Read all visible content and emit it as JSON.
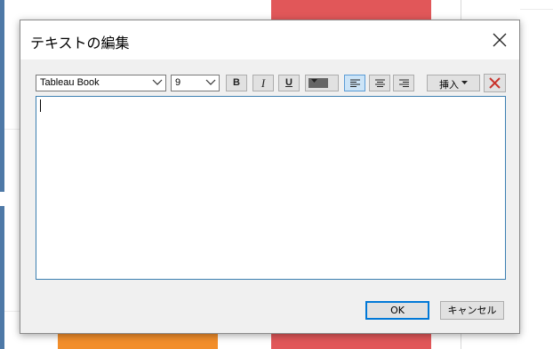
{
  "dialog": {
    "title": "テキストの編集",
    "close_icon": "close-icon"
  },
  "toolbar": {
    "font_family": "Tableau Book",
    "font_size": "9",
    "bold_label": "B",
    "italic_label": "I",
    "underline_label": "U",
    "text_color": "#666666",
    "alignment_selected": "left",
    "insert_label": "挿入",
    "clear_icon": "delete-x-icon",
    "clear_icon_color": "#c8322b"
  },
  "editor": {
    "content": ""
  },
  "buttons": {
    "ok_label": "OK",
    "cancel_label": "キャンセル"
  },
  "background": {
    "accent_blue": "#4e79a7",
    "accent_red": "#e15759",
    "accent_orange": "#f28e2b"
  }
}
